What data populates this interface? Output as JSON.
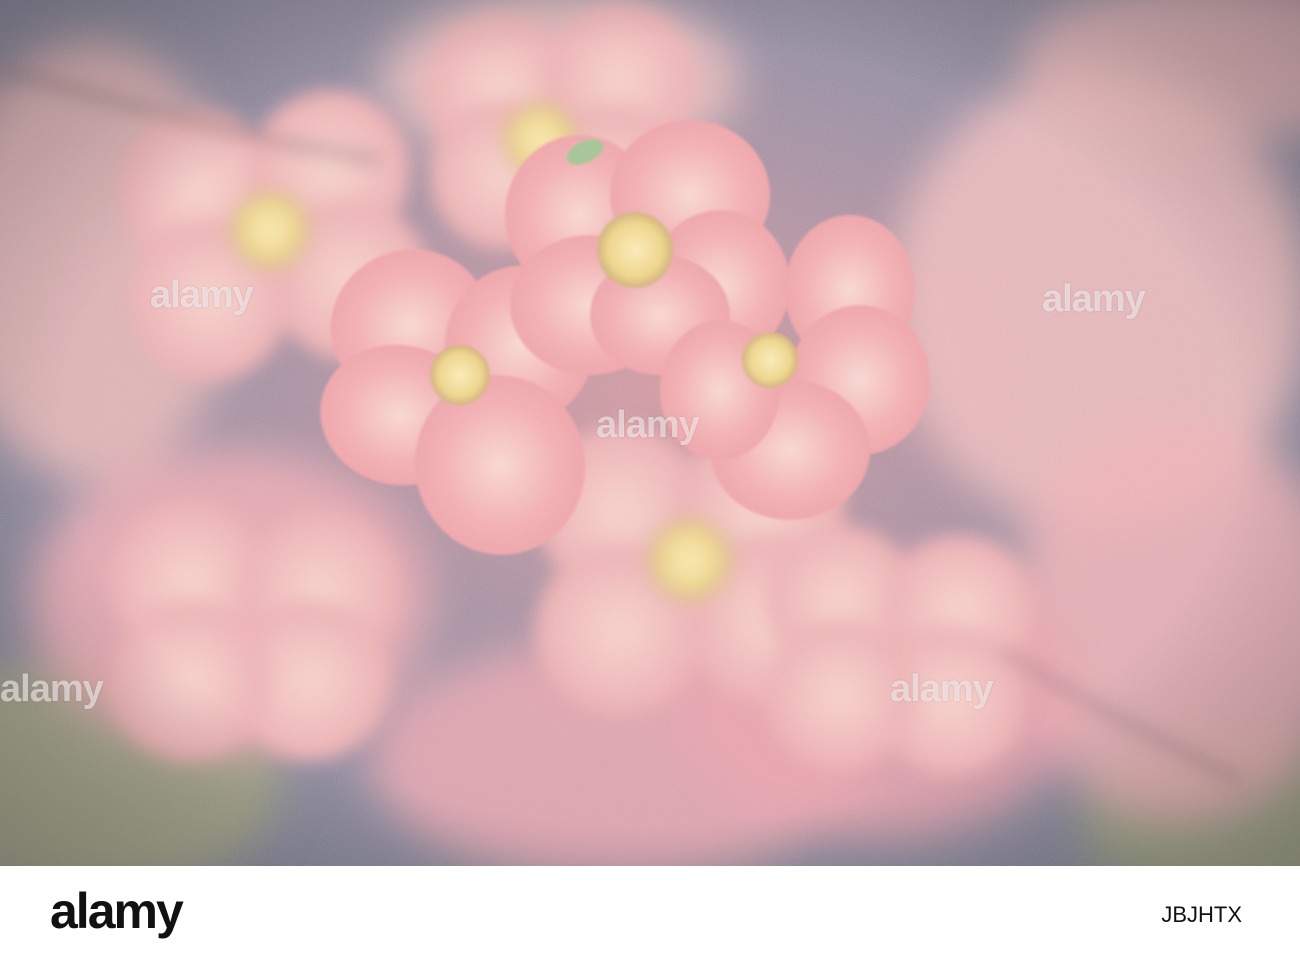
{
  "photo": {
    "subject": "pink-quince-blossoms",
    "colors": {
      "petal": "#f4a7b0",
      "petal_light": "#fbd3d0",
      "stamen": "#f3e08a",
      "background_blue": "#5e6f95",
      "background_green": "#8aa06a",
      "vintage_tint": "#e9c9b8"
    },
    "watermarks": [
      "alamy",
      "alamy",
      "alamy",
      "alamy",
      "alamy"
    ]
  },
  "footer": {
    "logo_text": "alamy",
    "image_id": "JBJHTX"
  }
}
